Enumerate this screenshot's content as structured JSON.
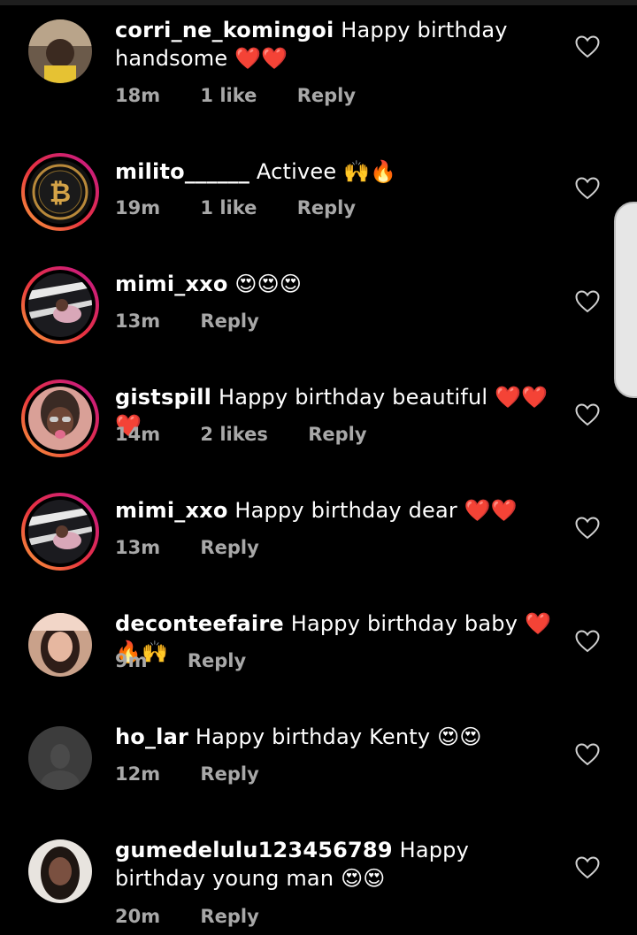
{
  "comments": [
    {
      "username": "corri_ne_komingoi",
      "text": "Happy birthday handsome",
      "emojis": "❤️❤️",
      "time": "18m",
      "likes": "1 like",
      "reply": "Reply"
    },
    {
      "username": "milito______",
      "text": "Activee",
      "emojis": "🙌🔥",
      "time": "19m",
      "likes": "1 like",
      "reply": "Reply"
    },
    {
      "username": "mimi_xxo",
      "text": "",
      "emojis": "😍😍😍",
      "time": "13m",
      "likes": "",
      "reply": "Reply"
    },
    {
      "username": "gistspill",
      "text": "Happy birthday beautiful",
      "emojis": "❤️❤️❤️",
      "time": "14m",
      "likes": "2 likes",
      "reply": "Reply"
    },
    {
      "username": "mimi_xxo",
      "text": "Happy birthday dear",
      "emojis": "❤️❤️",
      "time": "13m",
      "likes": "",
      "reply": "Reply"
    },
    {
      "username": "deconteefaire",
      "text": "Happy birthday baby",
      "emojis": "❤️🔥🙌",
      "time": "9m",
      "likes": "",
      "reply": "Reply"
    },
    {
      "username": "ho_lar",
      "text": "Happy birthday Kenty",
      "emojis": "😍😍",
      "time": "12m",
      "likes": "",
      "reply": "Reply"
    },
    {
      "username": "gumedelulu123456789",
      "text": "Happy birthday young man",
      "emojis": "😍😍",
      "time": "20m",
      "likes": "",
      "reply": "Reply"
    }
  ],
  "colors": {
    "background": "#000000",
    "meta_text": "#a8a8a8",
    "story_ring_start": "#f9a13a",
    "story_ring_end": "#c1168e"
  },
  "icons": {
    "like": "heart-outline-icon"
  }
}
